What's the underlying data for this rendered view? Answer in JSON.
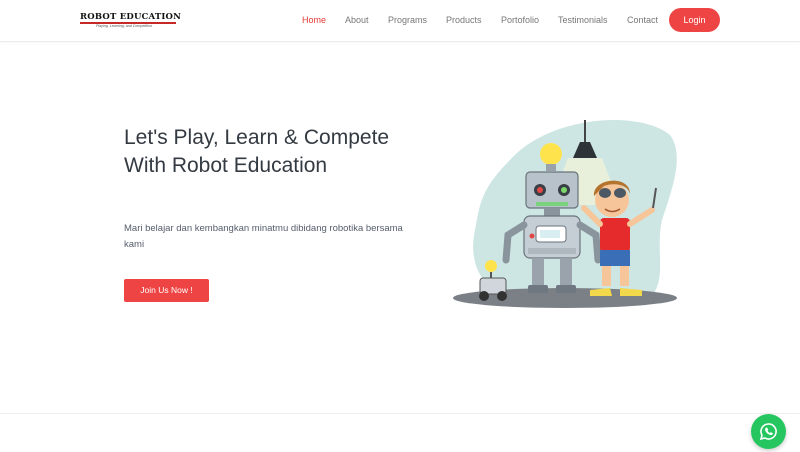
{
  "header": {
    "logo": {
      "text": "ROBOT EDUCATION",
      "tagline": "Playing, Learning, and Competition"
    },
    "nav": [
      {
        "label": "Home",
        "active": true
      },
      {
        "label": "About",
        "active": false
      },
      {
        "label": "Programs",
        "active": false
      },
      {
        "label": "Products",
        "active": false
      },
      {
        "label": "Portofolio",
        "active": false
      },
      {
        "label": "Testimonials",
        "active": false
      },
      {
        "label": "Contact",
        "active": false
      }
    ],
    "login_label": "Login"
  },
  "hero": {
    "title": "Let's Play, Learn & Compete With Robot Education",
    "subtitle": "Mari belajar dan kembangkan minatmu dibidang robotika bersama kami",
    "cta_label": "Join Us Now !"
  },
  "colors": {
    "accent": "#ef4444",
    "active_nav": "#e53935",
    "whatsapp": "#25c660",
    "illustration_bg": "#cde6e3"
  },
  "icons": {
    "floating": "whatsapp-icon"
  }
}
